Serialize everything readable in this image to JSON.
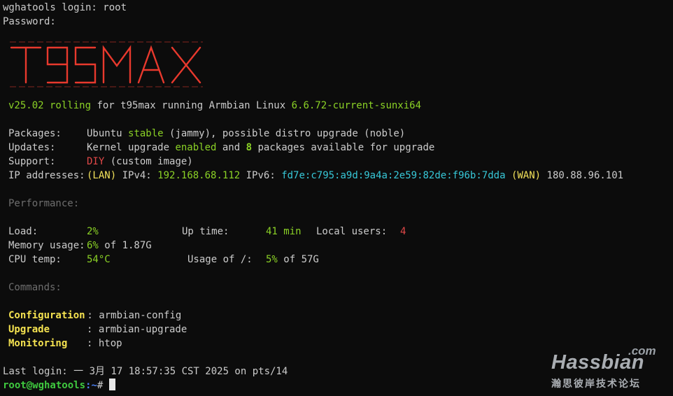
{
  "login_line": "wghatools login: root",
  "password_line": "Password:",
  "logo_text": "t95max",
  "banner": {
    "version": "v25.02 rolling",
    "for_word": " for t95max running Armbian Linux ",
    "kernel": "6.6.72-current-sunxi64"
  },
  "info": {
    "packages_label": "Packages:",
    "packages_pre": "Ubuntu ",
    "packages_stable": "stable",
    "packages_post": " (jammy), possible distro upgrade (noble)",
    "updates_label": "Updates:",
    "updates_pre": "Kernel upgrade ",
    "updates_enabled": "enabled",
    "updates_and": " and ",
    "updates_count": "8",
    "updates_post": " packages available for upgrade",
    "support_label": "Support:",
    "support_diy": "DIY",
    "support_post": " (custom image)",
    "ip_label": "IP addresses:",
    "ip_lan": "(LAN)",
    "ip_v4_label": " IPv4: ",
    "ip_v4": "192.168.68.112",
    "ip_v6_label": " IPv6: ",
    "ip_v6": "fd7e:c795:a9d:9a4a:2e59:82de:f96b:7dda",
    "ip_wan": "(WAN)",
    "ip_wan_addr": " 180.88.96.101"
  },
  "performance": {
    "heading": "Performance:",
    "load_label": "Load:",
    "load_value": "2%",
    "uptime_label": "Up time:",
    "uptime_value": "41 min",
    "users_label": "Local users:",
    "users_value": "4",
    "memory_label": "Memory usage:",
    "memory_value": "6%",
    "memory_of": " of 1.87G",
    "cpu_label": "CPU temp:",
    "cpu_value": "54°C",
    "usage_label": "Usage of /:",
    "usage_value": "5%",
    "usage_of": " of 57G"
  },
  "commands": {
    "heading": "Commands:",
    "items": [
      {
        "name": "Configuration",
        "sep": " : ",
        "cmd": "armbian-config"
      },
      {
        "name": "Upgrade",
        "sep": ": ",
        "cmd": "armbian-upgrade"
      },
      {
        "name": "Monitoring",
        "sep": ": ",
        "cmd": "htop"
      }
    ]
  },
  "last_login": "Last login: 一 3月 17 18:57:35 CST 2025 on pts/14",
  "prompt": {
    "user_host": "root@wghatools",
    "path": ":~",
    "symbol": "# "
  },
  "watermark": {
    "com": ".com",
    "name": "Hassbian",
    "subtitle": "瀚思彼岸技术论坛"
  },
  "colors": {
    "background": "#0c0c0c",
    "text": "#cccccc",
    "green": "#8bd226",
    "yellow": "#f1e05a",
    "cyan": "#37c8d8",
    "red": "#e04848",
    "logo_red": "#e8392d"
  }
}
